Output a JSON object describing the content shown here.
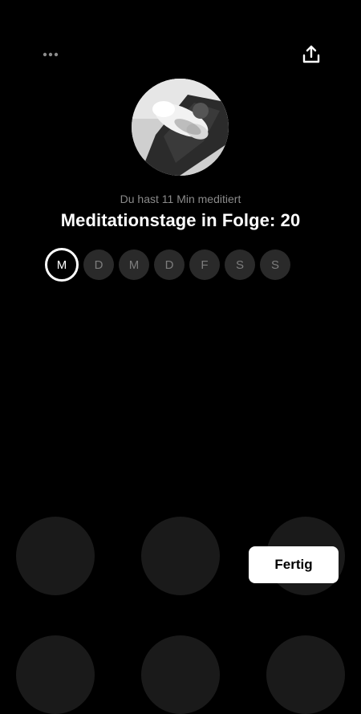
{
  "header": {
    "more_icon": "more-horizontal-icon",
    "share_icon": "share-upload-icon"
  },
  "profile": {
    "avatar": "profile-photo-dog-on-mat",
    "subtitle": "Du hast 11 Min meditiert",
    "headline": "Meditationstage in Folge: 20"
  },
  "week": {
    "days": [
      "M",
      "D",
      "M",
      "D",
      "F",
      "S",
      "S"
    ],
    "active_index": 0
  },
  "footer": {
    "done_label": "Fertig"
  },
  "colors": {
    "background": "#000000",
    "day_inactive_bg": "#2a2a2a",
    "bubble_bg": "#1a1a1a",
    "button_bg": "#ffffff"
  }
}
